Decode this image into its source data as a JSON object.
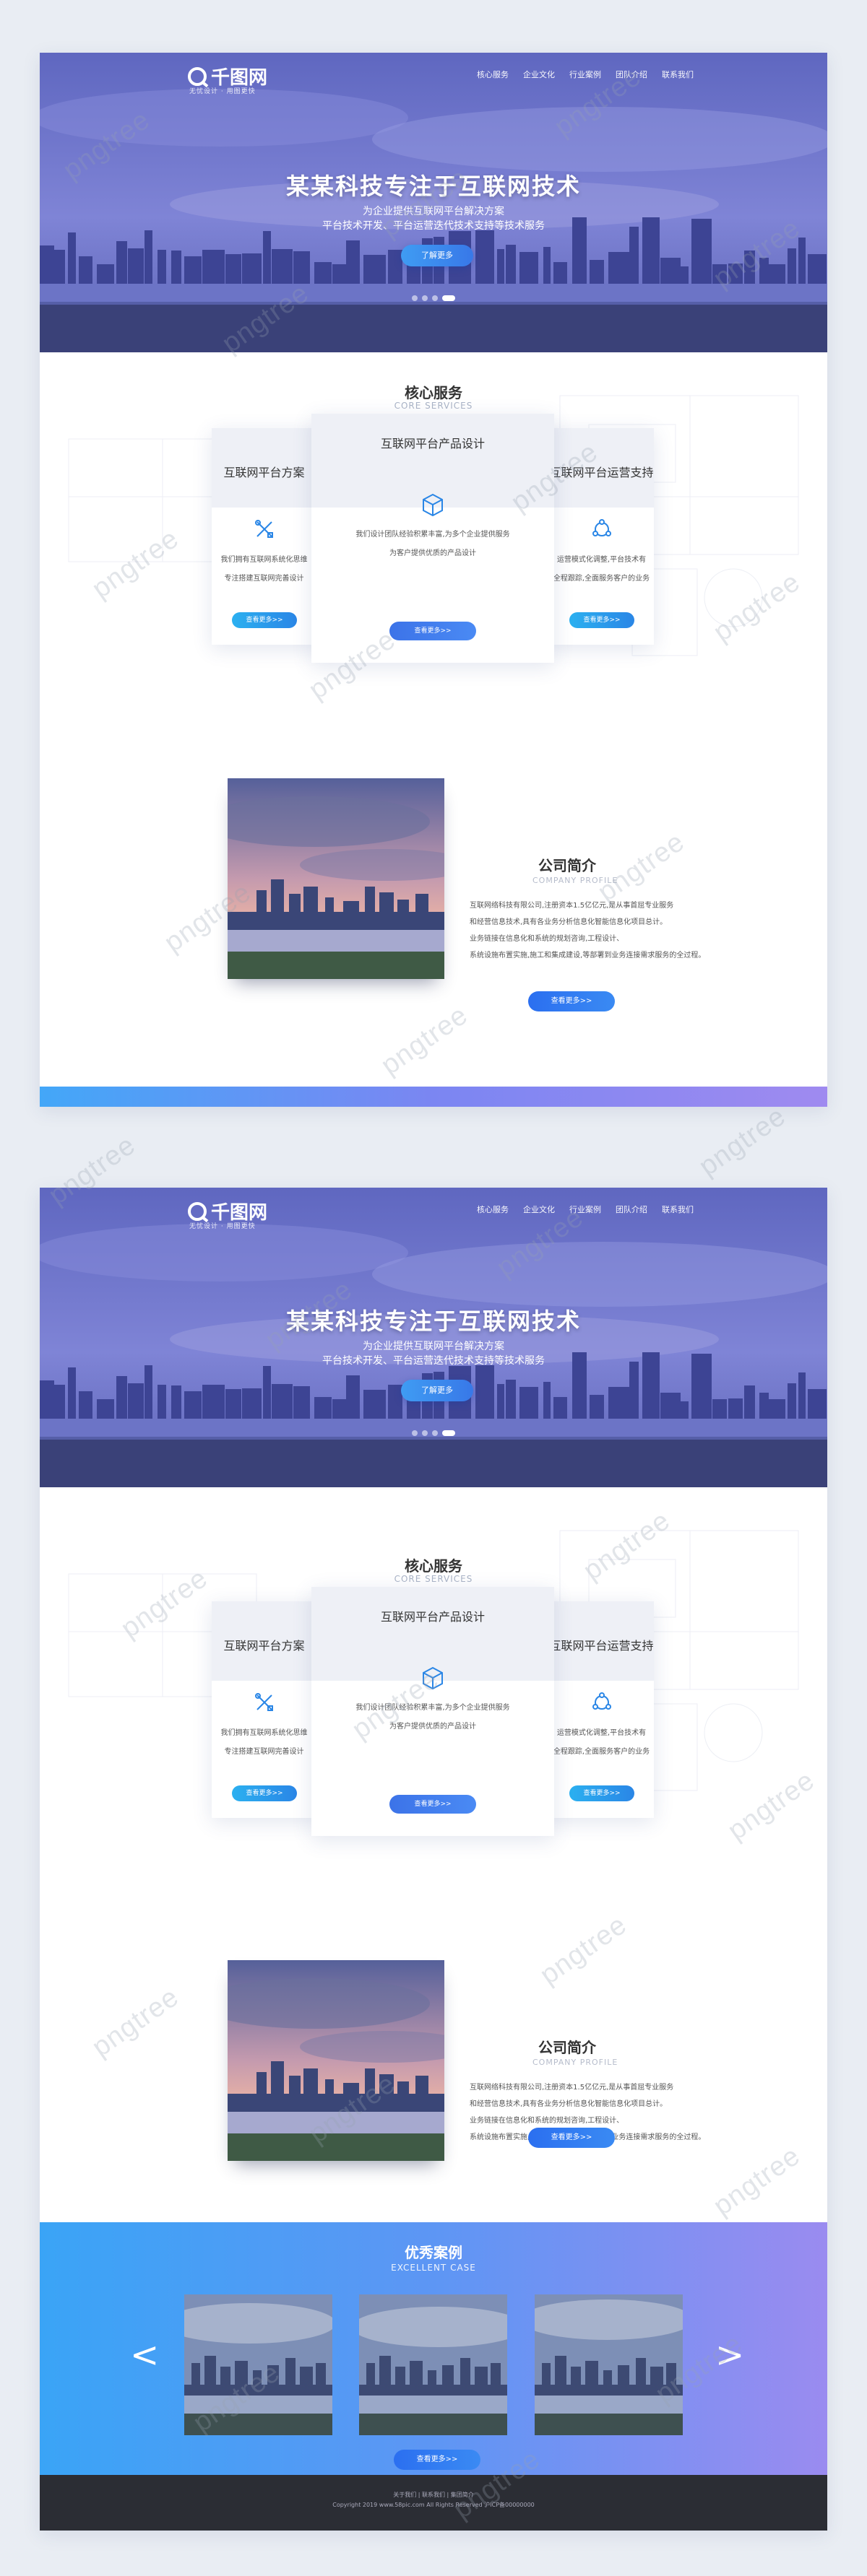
{
  "frames": [
    {
      "nav": {
        "logo_text": "千图网",
        "logo_sub": "无忧设计 · 用图更快",
        "menu": [
          "核心服务",
          "企业文化",
          "行业案例",
          "团队介绍",
          "联系我们"
        ]
      },
      "hero": {
        "title": "某某科技专注于互联网技术",
        "sub": [
          "为企业提供互联网平台解决方案",
          "平台技术开发、平台运营迭代技术支持等技术服务"
        ],
        "button": "了解更多",
        "slide_count": 4,
        "active_slide": 4
      },
      "services": {
        "title": "核心服务",
        "title_en": "CORE SERVICES",
        "cards": [
          {
            "title": "互联网平台方案",
            "icon": "tools-icon",
            "desc": [
              "我们拥有互联网系统化思维",
              "专注搭建互联网完善设计"
            ],
            "button": "查看更多>>"
          },
          {
            "title": "互联网平台产品设计",
            "icon": "cube-icon",
            "desc": [
              "我们设计团队经验积累丰富,为多个企业提供服务",
              "为客户提供优质的产品设计"
            ],
            "button": "查看更多>>"
          },
          {
            "title": "互联网平台运营支持",
            "icon": "network-icon",
            "desc": [
              "运营模式化调整,平台技术有",
              "全程跟踪,全面服务客户的业务"
            ],
            "button": "查看更多>>"
          }
        ]
      },
      "profile": {
        "title": "公司简介",
        "title_en": "COMPANY PROFILE",
        "text": [
          "互联网络科技有限公司,注册资本1.5亿亿元,是从事首屈专业服务",
          "和经营信息技术,具有各业务分析信息化智能信息化项目总计。",
          "业务链接在信息化和系统的规划咨询,工程设计、",
          "系统设施布置实施,施工和集成建设,等部署到业务连接需求服务的全过程。"
        ],
        "button": "查看更多>>"
      }
    },
    {
      "nav": {
        "logo_text": "千图网",
        "logo_sub": "无忧设计 · 用图更快",
        "menu": [
          "核心服务",
          "企业文化",
          "行业案例",
          "团队介绍",
          "联系我们"
        ]
      },
      "hero": {
        "title": "某某科技专注于互联网技术",
        "sub": [
          "为企业提供互联网平台解决方案",
          "平台技术开发、平台运营迭代技术支持等技术服务"
        ],
        "button": "了解更多",
        "slide_count": 4,
        "active_slide": 4
      },
      "services": {
        "title": "核心服务",
        "title_en": "CORE SERVICES",
        "cards": [
          {
            "title": "互联网平台方案",
            "icon": "tools-icon",
            "desc": [
              "我们拥有互联网系统化思维",
              "专注搭建互联网完善设计"
            ],
            "button": "查看更多>>"
          },
          {
            "title": "互联网平台产品设计",
            "icon": "cube-icon",
            "desc": [
              "我们设计团队经验积累丰富,为多个企业提供服务",
              "为客户提供优质的产品设计"
            ],
            "button": "查看更多>>"
          },
          {
            "title": "互联网平台运营支持",
            "icon": "network-icon",
            "desc": [
              "运营模式化调整,平台技术有",
              "全程跟踪,全面服务客户的业务"
            ],
            "button": "查看更多>>"
          }
        ]
      },
      "profile": {
        "title": "公司简介",
        "title_en": "COMPANY PROFILE",
        "text": [
          "互联网络科技有限公司,注册资本1.5亿亿元,是从事首屈专业服务",
          "和经营信息技术,具有各业务分析信息化智能信息化项目总计。",
          "业务链接在信息化和系统的规划咨询,工程设计、",
          "系统设施布置实施,施工和集成建设,等部署到业务连接需求服务的全过程。"
        ],
        "button": "查看更多>>"
      },
      "cases": {
        "title": "优秀案例",
        "title_en": "EXCELLENT CASE",
        "button": "查看更多>>",
        "prev": "<",
        "next": ">"
      },
      "footer": {
        "line1": "关于我们 | 联系我们 | 集团简介",
        "line2": "Copyright 2019 www.58pic.com All Rights Reserved 沪ICP备00000000"
      }
    }
  ],
  "watermark": "pngtree",
  "colors": {
    "accent": "#3a7cf0",
    "hero_tint": "#6d73c9",
    "case_grad_start": "#3aa4f6",
    "case_grad_end": "#9a8bf0",
    "footer": "#2b2d34"
  }
}
